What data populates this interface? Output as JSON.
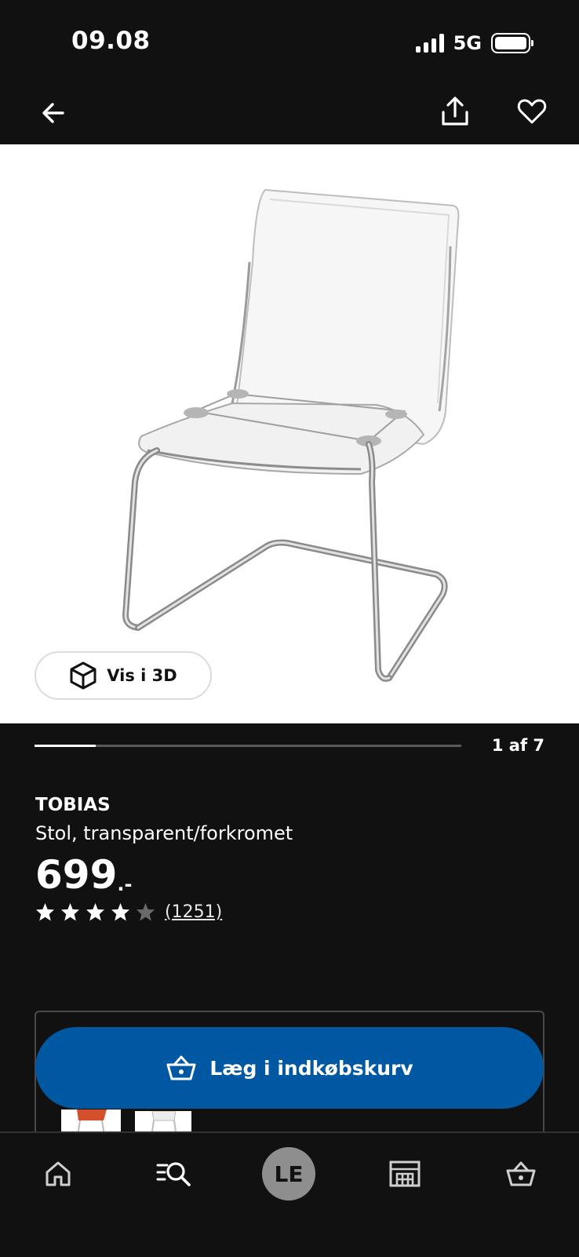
{
  "status": {
    "time": "09.08",
    "network": "5G"
  },
  "product": {
    "name": "TOBIAS",
    "description": "Stol, transparent/forkromet",
    "price": "699",
    "price_suffix": ".-",
    "rating": 4,
    "rating_max": 5,
    "review_count": "(1251)"
  },
  "gallery": {
    "view3d_label": "Vis i 3D",
    "counter": "1 af 7",
    "current": 1,
    "total": 7
  },
  "actions": {
    "add_to_cart_label": "Læg i indkøbskurv"
  },
  "tabbar": {
    "avatar_initials": "LE"
  },
  "colors": {
    "background": "#111111",
    "accent": "#0058a3",
    "hero_bg": "#ffffff"
  },
  "icons": [
    "back-arrow-icon",
    "share-icon",
    "heart-icon",
    "cube-3d-icon",
    "star-icon",
    "basket-icon",
    "home-icon",
    "search-list-icon",
    "store-icon",
    "cart-icon"
  ]
}
